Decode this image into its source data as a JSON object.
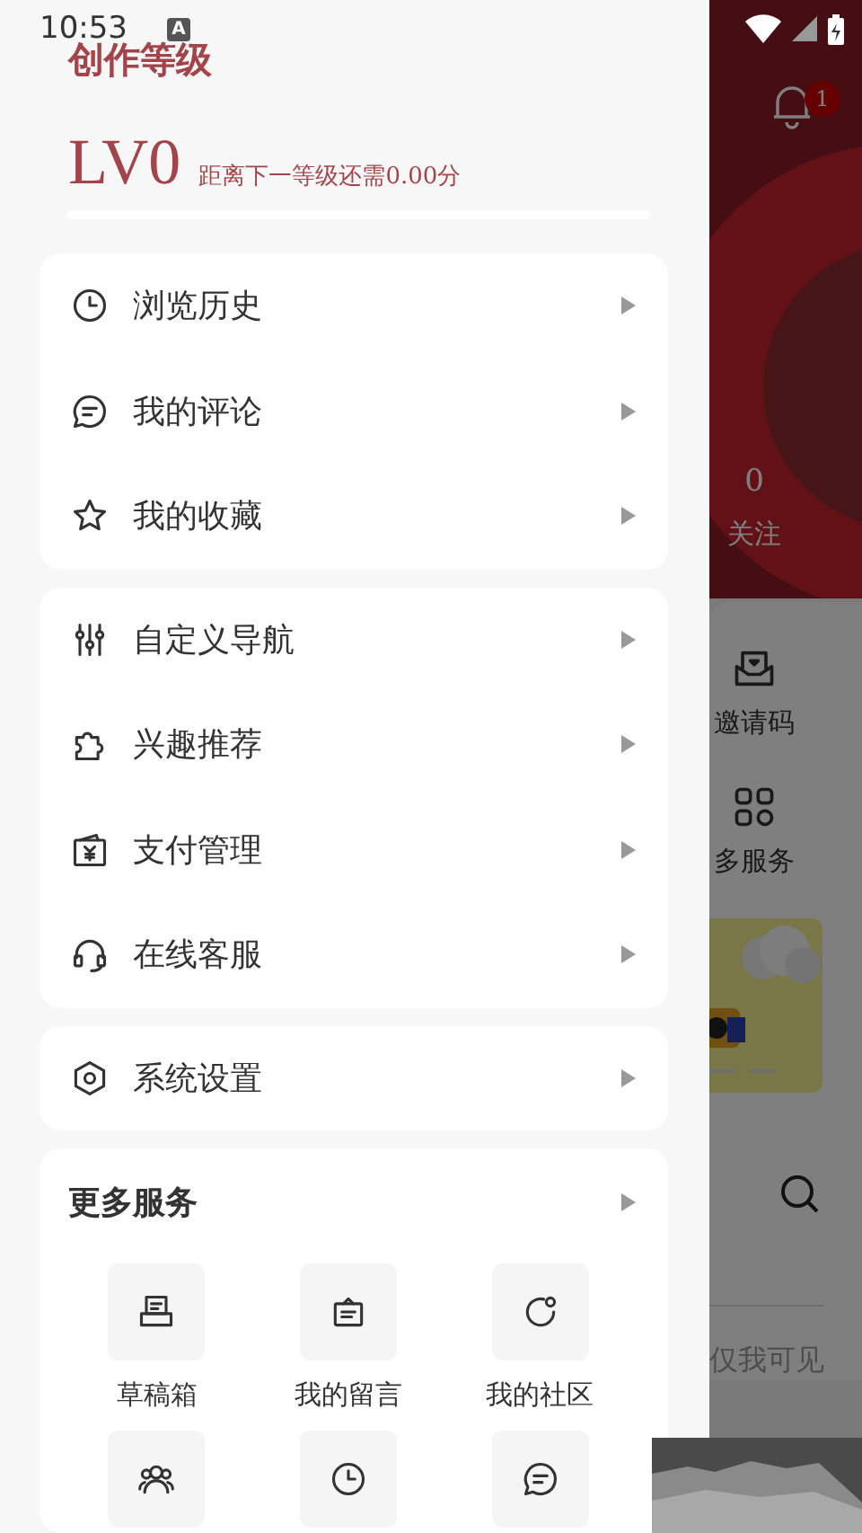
{
  "status_bar": {
    "time": "10:53",
    "notification": "A"
  },
  "drawer": {
    "title": "创作等级",
    "level_label": "LV0",
    "level_hint": "距离下一等级还需0.00分",
    "groups": [
      {
        "items": [
          {
            "kind": "clock",
            "label": "浏览历史"
          },
          {
            "kind": "chat",
            "label": "我的评论"
          },
          {
            "kind": "star",
            "label": "我的收藏"
          }
        ]
      },
      {
        "items": [
          {
            "kind": "sliders",
            "label": "自定义导航"
          },
          {
            "kind": "puzzle",
            "label": "兴趣推荐"
          },
          {
            "kind": "wallet",
            "label": "支付管理"
          },
          {
            "kind": "headset",
            "label": "在线客服"
          }
        ]
      },
      {
        "items": [
          {
            "kind": "hexagon",
            "label": "系统设置"
          }
        ]
      }
    ],
    "more_services": {
      "title": "更多服务",
      "items": [
        {
          "kind": "drafts",
          "label": "草稿箱"
        },
        {
          "kind": "note",
          "label": "我的留言"
        },
        {
          "kind": "community",
          "label": "我的社区"
        },
        {
          "kind": "people"
        },
        {
          "kind": "clock"
        },
        {
          "kind": "chat"
        }
      ]
    }
  },
  "background_page": {
    "notification_count": "1",
    "follow_count": "0",
    "follow_label": "关注",
    "services": [
      {
        "kind": "inbox",
        "label": "邀请码"
      },
      {
        "kind": "grid",
        "label": "多服务"
      }
    ],
    "visibility": "仅我可见"
  }
}
